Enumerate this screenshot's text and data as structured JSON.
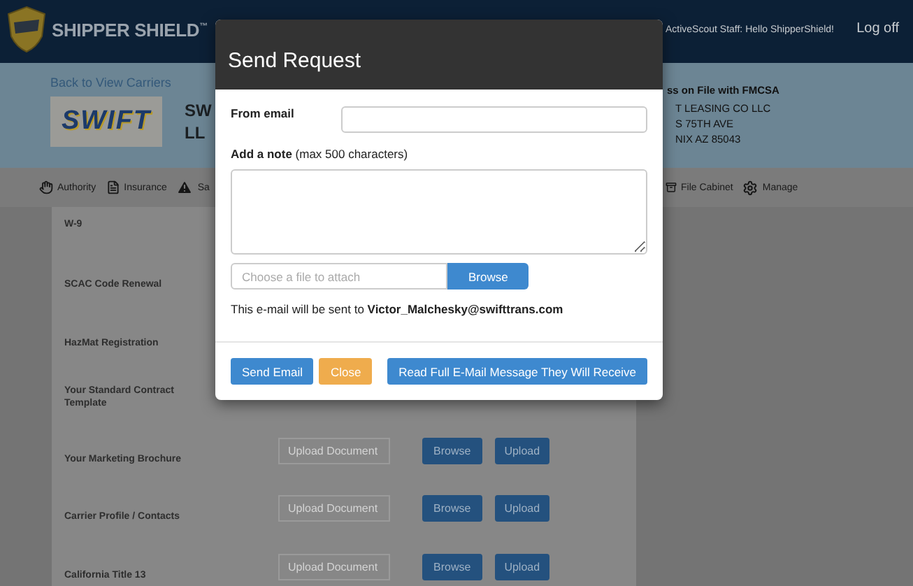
{
  "header": {
    "brand": "SHIPPER SHIELD$^{™}$",
    "greeting": "ActiveScout Staff: Hello ShipperShield!",
    "logout": "Log off"
  },
  "carrier": {
    "back_link": "Back to View Carriers",
    "logo_text": "SWIFT",
    "name_lines": [
      "SW",
      "LL"
    ],
    "address_title": "ss on File with FMCSA",
    "address_lines": [
      "T LEASING CO LLC",
      "S 75TH AVE",
      "NIX AZ 85043"
    ]
  },
  "toolbar": {
    "left": [
      {
        "label": "Authority"
      },
      {
        "label": "Insurance"
      },
      {
        "label": "Sa"
      }
    ],
    "right": [
      {
        "label": "File Cabinet"
      },
      {
        "label": "Manage"
      }
    ]
  },
  "documents": [
    {
      "label": "W-9"
    },
    {
      "label": "SCAC Code Renewal"
    },
    {
      "label": "HazMat Registration"
    },
    {
      "label": "Your Standard Contract Template"
    },
    {
      "label": "Your Marketing Brochure",
      "upload_placeholder": "Upload Document",
      "browse": "Browse",
      "upload": "Upload"
    },
    {
      "label": "Carrier Profile / Contacts",
      "upload_placeholder": "Upload Document",
      "browse": "Browse",
      "upload": "Upload"
    },
    {
      "label": "California Title 13",
      "upload_placeholder": "Upload Document",
      "browse": "Browse",
      "upload": "Upload"
    }
  ],
  "modal": {
    "title": "Send Request",
    "from_label": "From email",
    "note_label": "**Add a note** (max 500 characters)",
    "file_placeholder": "Choose a file to attach",
    "browse": "Browse",
    "recipient_text": "This e-mail will be sent to **Victor_Malchesky@swifttrans.com**",
    "buttons": [
      {
        "label": "Send Email",
        "kind": "primary"
      },
      {
        "label": "Close",
        "kind": "warning"
      },
      {
        "label": "Read Full E-Mail Message They Will Receive",
        "kind": "primary"
      }
    ]
  }
}
